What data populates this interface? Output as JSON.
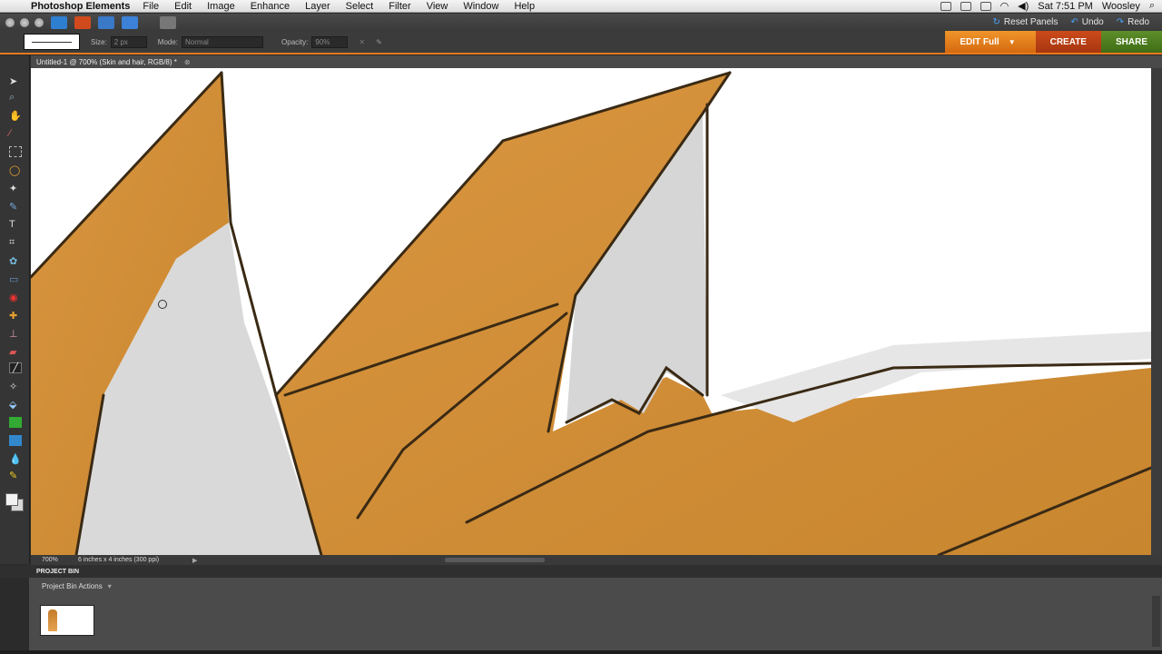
{
  "menubar": {
    "app_name": "Photoshop Elements",
    "items": [
      "File",
      "Edit",
      "Image",
      "Enhance",
      "Layer",
      "Select",
      "Filter",
      "View",
      "Window",
      "Help"
    ],
    "clock": "Sat 7:51 PM",
    "user": "Woosley"
  },
  "shortcuts": {
    "reset_panels": "Reset Panels",
    "undo": "Undo",
    "redo": "Redo"
  },
  "options": {
    "size_label": "Size:",
    "size_value": "2 px",
    "mode_label": "Mode:",
    "mode_value": "Normal",
    "opacity_label": "Opacity:",
    "opacity_value": "90%"
  },
  "modes": {
    "edit": "EDIT Full",
    "create": "CREATE",
    "share": "SHARE"
  },
  "document": {
    "tab_title": "Untitled-1 @ 700% (Skin and hair, RGB/8) *",
    "zoom": "700%",
    "info": "6 inches x 4 inches (300 ppi)"
  },
  "bin": {
    "header": "PROJECT BIN",
    "actions": "Project Bin Actions"
  },
  "colors": {
    "accent_orange": "#e8791e",
    "hair": "#c98a3c",
    "skin_shadow": "#d7d7d7",
    "outline": "#3a2a14"
  }
}
